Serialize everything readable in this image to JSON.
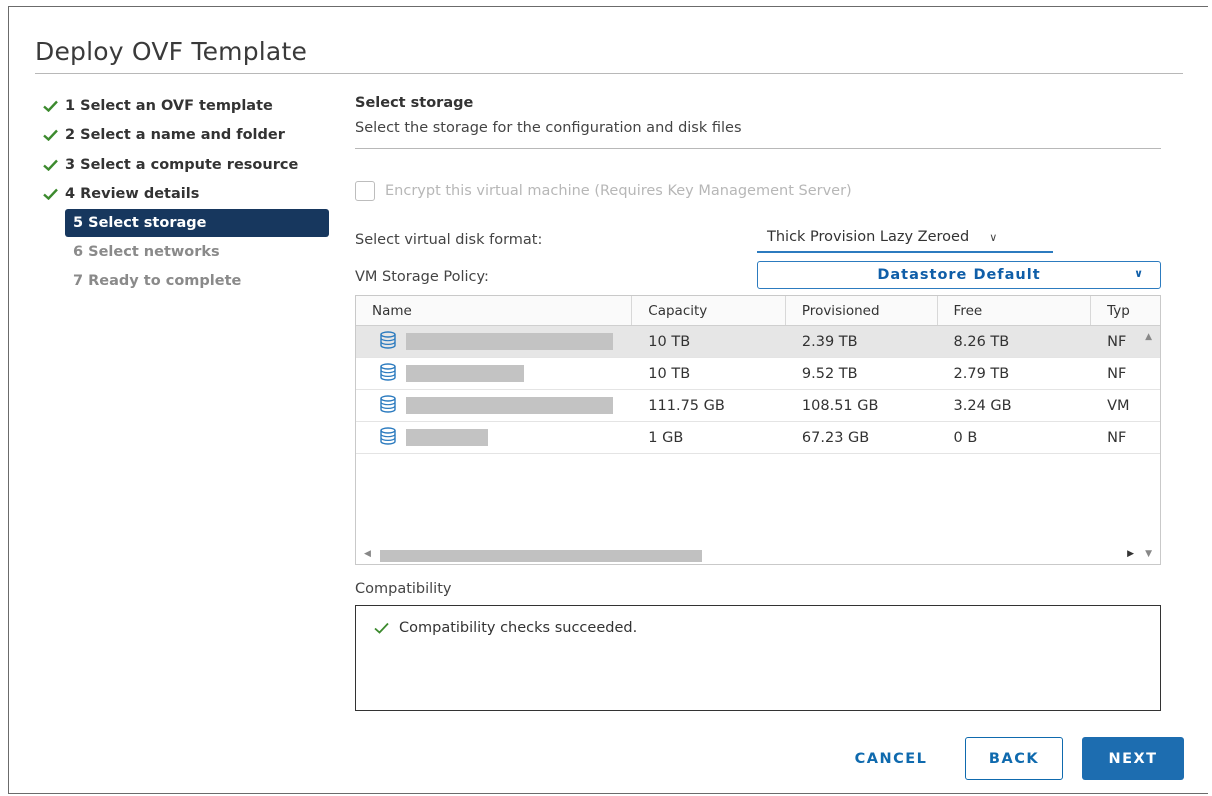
{
  "dialog": {
    "title": "Deploy OVF Template"
  },
  "steps": [
    {
      "label": "1 Select an OVF template",
      "state": "done"
    },
    {
      "label": "2 Select a name and folder",
      "state": "done"
    },
    {
      "label": "3 Select a compute resource",
      "state": "done"
    },
    {
      "label": "4 Review details",
      "state": "done"
    },
    {
      "label": "5 Select storage",
      "state": "active"
    },
    {
      "label": "6 Select networks",
      "state": "pending"
    },
    {
      "label": "7 Ready to complete",
      "state": "pending"
    }
  ],
  "section": {
    "title": "Select storage",
    "subtitle": "Select the storage for the configuration and disk files"
  },
  "encrypt": {
    "label": "Encrypt this virtual machine (Requires Key Management Server)",
    "checked": false,
    "disabled": true
  },
  "disk_format": {
    "label": "Select virtual disk format:",
    "value": "Thick Provision Lazy Zeroed"
  },
  "storage_policy": {
    "label": "VM Storage Policy:",
    "value": "Datastore Default"
  },
  "table": {
    "columns": [
      "Name",
      "Capacity",
      "Provisioned",
      "Free",
      "Typ"
    ],
    "rows": [
      {
        "name_redacted": true,
        "capacity": "10 TB",
        "provisioned": "2.39 TB",
        "free": "8.26 TB",
        "type": "NF",
        "selected": true
      },
      {
        "name_redacted": true,
        "capacity": "10 TB",
        "provisioned": "9.52 TB",
        "free": "2.79 TB",
        "type": "NF",
        "selected": false
      },
      {
        "name_redacted": true,
        "capacity": "111.75 GB",
        "provisioned": "108.51 GB",
        "free": "3.24 GB",
        "type": "VM",
        "selected": false
      },
      {
        "name_redacted": true,
        "capacity": "1 GB",
        "provisioned": "67.23 GB",
        "free": "0 B",
        "type": "NF",
        "selected": false
      }
    ]
  },
  "compatibility": {
    "label": "Compatibility",
    "message": "Compatibility checks succeeded."
  },
  "buttons": {
    "cancel": "CANCEL",
    "back": "BACK",
    "next": "NEXT"
  },
  "colors": {
    "accent": "#1d6db0",
    "active_step": "#17375e",
    "check": "#3c8a2e"
  }
}
